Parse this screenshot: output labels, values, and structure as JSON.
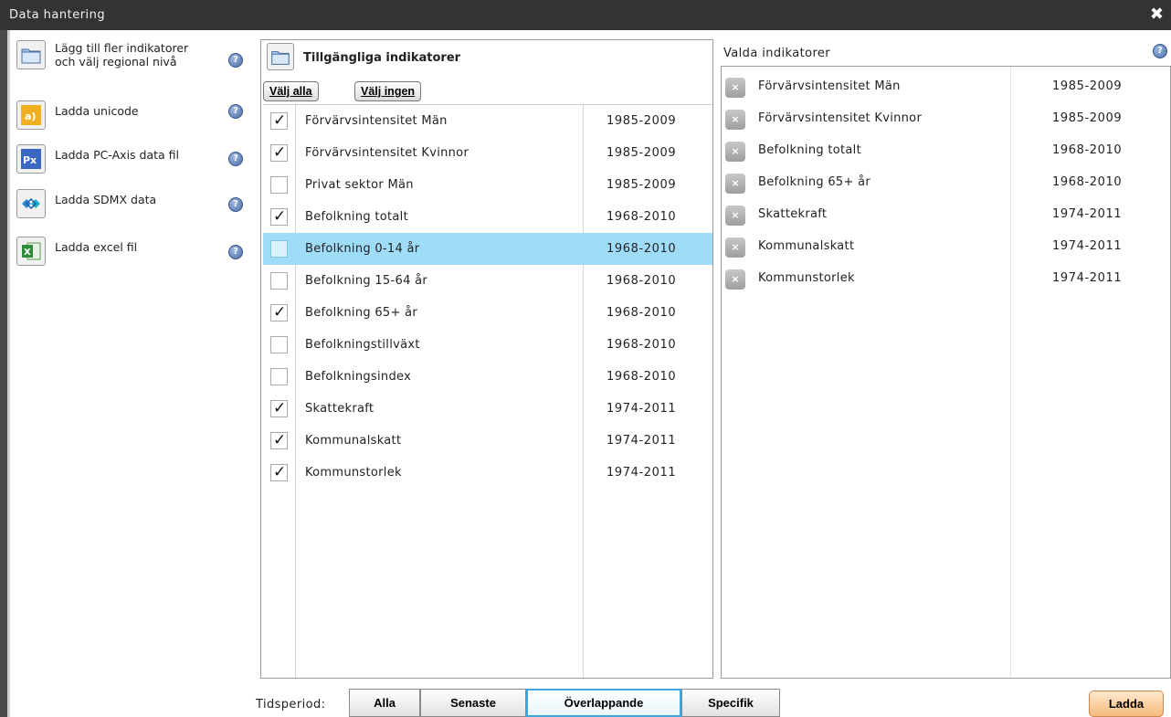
{
  "window": {
    "title": "Data hantering",
    "close_glyph": "✖"
  },
  "sidebar": {
    "items": [
      {
        "label": "Lägg till fler indikatorer\noch välj regional nivå",
        "icon": "folder-icon"
      },
      {
        "label": "Ladda unicode",
        "icon": "unicode-icon"
      },
      {
        "label": "Ladda PC-Axis data fil",
        "icon": "pc-axis-icon"
      },
      {
        "label": "Ladda SDMX data",
        "icon": "sdmx-icon"
      },
      {
        "label": "Ladda excel fil",
        "icon": "excel-icon"
      }
    ],
    "help_glyph": "?"
  },
  "available": {
    "title": "Tillgängliga indikatorer",
    "select_all": "Välj alla",
    "select_none": "Välj ingen",
    "rows": [
      {
        "name": "Förvärvsintensitet Män",
        "years": "1985-2009",
        "checked": true
      },
      {
        "name": "Förvärvsintensitet Kvinnor",
        "years": "1985-2009",
        "checked": true
      },
      {
        "name": "Privat sektor Män",
        "years": "1985-2009",
        "checked": false
      },
      {
        "name": "Befolkning totalt",
        "years": "1968-2010",
        "checked": true
      },
      {
        "name": "Befolkning 0-14 år",
        "years": "1968-2010",
        "checked": false,
        "highlighted": true
      },
      {
        "name": "Befolkning 15-64 år",
        "years": "1968-2010",
        "checked": false
      },
      {
        "name": "Befolkning 65+ år",
        "years": "1968-2010",
        "checked": true
      },
      {
        "name": "Befolkningstillväxt",
        "years": "1968-2010",
        "checked": false
      },
      {
        "name": "Befolkningsindex",
        "years": "1968-2010",
        "checked": false
      },
      {
        "name": "Skattekraft",
        "years": "1974-2011",
        "checked": true
      },
      {
        "name": "Kommunalskatt",
        "years": "1974-2011",
        "checked": true
      },
      {
        "name": "Kommunstorlek",
        "years": "1974-2011",
        "checked": true
      }
    ]
  },
  "selected": {
    "title": "Valda indikatorer",
    "remove_glyph": "×",
    "rows": [
      {
        "name": "Förvärvsintensitet Män",
        "years": "1985-2009"
      },
      {
        "name": "Förvärvsintensitet Kvinnor",
        "years": "1985-2009"
      },
      {
        "name": "Befolkning totalt",
        "years": "1968-2010"
      },
      {
        "name": "Befolkning 65+ år",
        "years": "1968-2010"
      },
      {
        "name": "Skattekraft",
        "years": "1974-2011"
      },
      {
        "name": "Kommunalskatt",
        "years": "1974-2011"
      },
      {
        "name": "Kommunstorlek",
        "years": "1974-2011"
      }
    ]
  },
  "bottom": {
    "period_label": "Tidsperiod:",
    "segments": [
      "Alla",
      "Senaste",
      "Överlappande",
      "Specifik"
    ],
    "active_segment": "Överlappande",
    "load_button": "Ladda"
  },
  "colors": {
    "titlebar": "#333333",
    "highlight_row": "#9fdcf8",
    "active_segment_border": "#3ea6df",
    "load_button": "#f5b97c"
  }
}
